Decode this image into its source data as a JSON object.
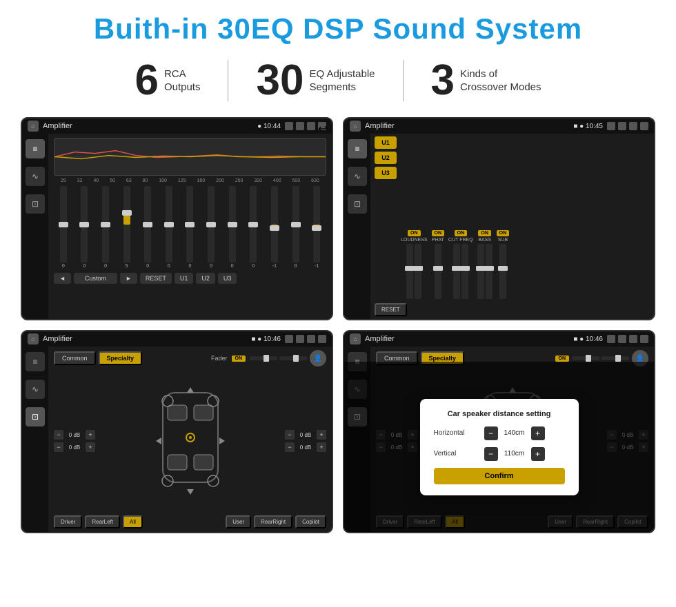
{
  "page": {
    "title": "Buith-in 30EQ DSP Sound System",
    "stats": [
      {
        "number": "6",
        "label": "RCA\nOutputs"
      },
      {
        "number": "30",
        "label": "EQ Adjustable\nSegments"
      },
      {
        "number": "3",
        "label": "Kinds of\nCrossover Modes"
      }
    ],
    "screens": [
      {
        "id": "screen1",
        "title": "Amplifier",
        "time": "10:44",
        "type": "eq",
        "freqs": [
          "25",
          "32",
          "40",
          "50",
          "63",
          "80",
          "100",
          "125",
          "160",
          "200",
          "250",
          "320",
          "400",
          "500",
          "630"
        ],
        "eq_values": [
          "0",
          "0",
          "0",
          "5",
          "0",
          "0",
          "0",
          "0",
          "0",
          "0",
          "-1",
          "0",
          "-1"
        ],
        "nav_items": [
          "◄",
          "Custom",
          "►",
          "RESET",
          "U1",
          "U2",
          "U3"
        ]
      },
      {
        "id": "screen2",
        "title": "Amplifier",
        "time": "10:45",
        "type": "amplifier",
        "u_buttons": [
          "U1",
          "U2",
          "U3"
        ],
        "controls": [
          "LOUDNESS",
          "PHAT",
          "CUT FREQ",
          "BASS",
          "SUB"
        ],
        "reset_label": "RESET"
      },
      {
        "id": "screen3",
        "title": "Amplifier",
        "time": "10:46",
        "type": "speaker",
        "tabs": [
          "Common",
          "Specialty"
        ],
        "active_tab": "Specialty",
        "fader_label": "Fader",
        "fader_on": "ON",
        "db_values": [
          "0 dB",
          "0 dB",
          "0 dB",
          "0 dB"
        ],
        "bottom_nav": [
          "Driver",
          "RearLeft",
          "All",
          "User",
          "RearRight",
          "Copilot"
        ]
      },
      {
        "id": "screen4",
        "title": "Amplifier",
        "time": "10:46",
        "type": "speaker_dialog",
        "tabs": [
          "Common",
          "Specialty"
        ],
        "dialog": {
          "title": "Car speaker distance setting",
          "rows": [
            {
              "label": "Horizontal",
              "value": "140cm"
            },
            {
              "label": "Vertical",
              "value": "110cm"
            }
          ],
          "confirm_label": "Confirm"
        },
        "db_values": [
          "0 dB",
          "0 dB"
        ],
        "bottom_nav": [
          "Driver",
          "RearLeft",
          "All",
          "User",
          "RearRight",
          "Copilot"
        ]
      }
    ]
  }
}
